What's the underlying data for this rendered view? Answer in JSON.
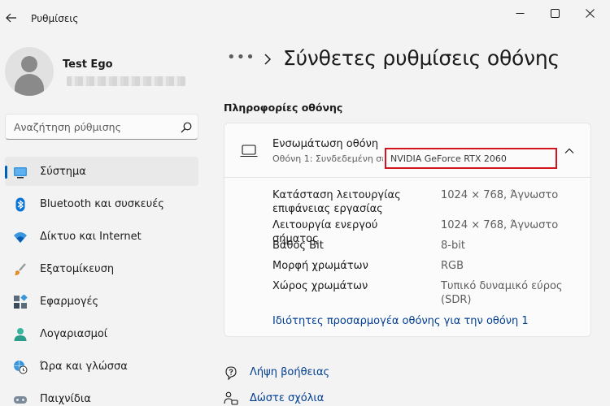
{
  "window": {
    "title": "Ρυθμίσεις"
  },
  "profile": {
    "name": "Test Ego"
  },
  "search": {
    "placeholder": "Αναζήτηση ρύθμισης"
  },
  "sidebar": {
    "items": [
      {
        "label": "Σύστημα",
        "icon": "system-icon",
        "active": true
      },
      {
        "label": "Bluetooth και συσκευές",
        "icon": "bluetooth-icon"
      },
      {
        "label": "Δίκτυο και Internet",
        "icon": "wifi-icon"
      },
      {
        "label": "Εξατομίκευση",
        "icon": "brush-icon"
      },
      {
        "label": "Εφαρμογές",
        "icon": "apps-icon"
      },
      {
        "label": "Λογαριασμοί",
        "icon": "account-icon"
      },
      {
        "label": "Ώρα και γλώσσα",
        "icon": "globe-clock-icon"
      },
      {
        "label": "Παιχνίδια",
        "icon": "gamepad-icon"
      }
    ]
  },
  "breadcrumb": {
    "more": "•••",
    "title": "Σύνθετες ρυθμίσεις οθόνης"
  },
  "section": {
    "title": "Πληροφορίες οθόνης"
  },
  "display_card": {
    "title": "Ενσωμάτωση οθόνη",
    "subtitle": "Οθόνη 1: Συνδεδεμένη σε",
    "gpu": "NVIDIA GeForce RTX 2060",
    "rows": [
      {
        "label": "Κατάσταση λειτουργίας επιφάνειας εργασίας",
        "value": "1024 × 768, Άγνωστο"
      },
      {
        "label": "Λειτουργία ενεργού σήματος",
        "value": "1024 × 768, Άγνωστο"
      },
      {
        "label": "Βάθος Bit",
        "value": "8-bit"
      },
      {
        "label": "Μορφή χρωμάτων",
        "value": "RGB"
      },
      {
        "label": "Χώρος χρωμάτων",
        "value": "Τυπικό δυναμικό εύρος (SDR)"
      }
    ],
    "link": "Ιδιότητες προσαρμογέα οθόνης για την οθόνη 1"
  },
  "help": {
    "get_help": "Λήψη βοήθειας",
    "feedback": "Δώστε σχόλια"
  },
  "colors": {
    "accent": "#005fb8",
    "link": "#003e92",
    "highlight_box": "#d4141c"
  }
}
